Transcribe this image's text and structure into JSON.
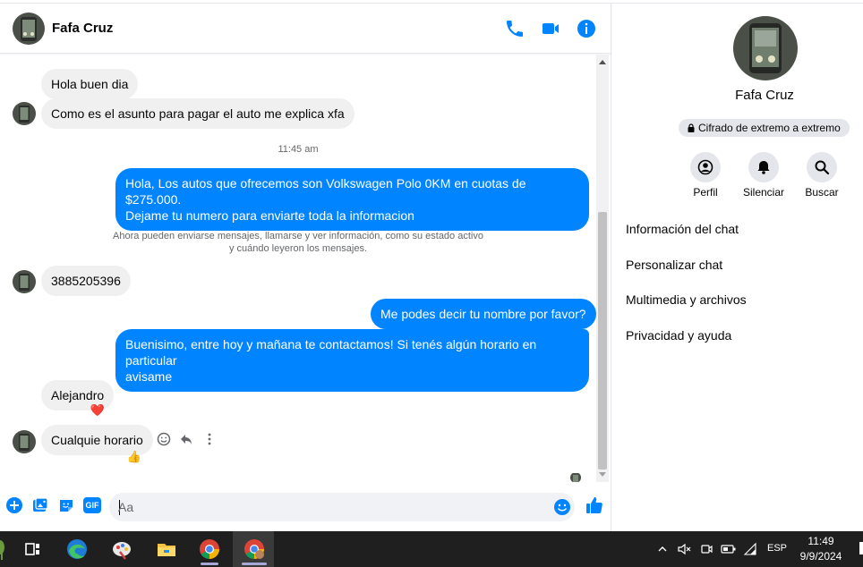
{
  "contact": {
    "name": "Fafa Cruz"
  },
  "messages": {
    "m1": "Hola buen dia",
    "m2": "Como es el asunto para pagar el auto me explica xfa",
    "time1": "11:45 am",
    "m3_line1": "Hola, Los autos que ofrecemos son Volkswagen Polo 0KM en cuotas de $275.000.",
    "m3_line2": "Dejame tu numero para enviarte toda la informacion",
    "notice_line1": "Ahora pueden enviarse mensajes, llamarse y ver información, como su estado activo",
    "notice_line2": "y cuándo leyeron los mensajes.",
    "m4": "3885205396",
    "m5": "Me podes decir tu nombre por favor?",
    "m6_line1": "Buenisimo, entre hoy y mañana te contactamos! Si tenés algún horario en particular",
    "m6_line2": "avisame",
    "m7": "Alejandro",
    "m7_reaction": "❤️",
    "m8": "Cualquie horario",
    "m8_reaction": "👍"
  },
  "composer": {
    "placeholder": "Aa",
    "gif_label": "GIF"
  },
  "side": {
    "name": "Fafa Cruz",
    "encryption": "Cifrado de extremo a extremo",
    "buttons": {
      "profile": "Perfil",
      "mute": "Silenciar",
      "search": "Buscar"
    },
    "menu": {
      "chat_info": "Información del chat",
      "customize": "Personalizar chat",
      "media": "Multimedia y archivos",
      "privacy": "Privacidad y ayuda"
    }
  },
  "taskbar": {
    "language": "ESP",
    "time": "11:49",
    "date": "9/9/2024"
  },
  "colors": {
    "accent": "#0084ff",
    "incoming": "#f0f0f0",
    "taskbar": "#1f1f1f"
  }
}
